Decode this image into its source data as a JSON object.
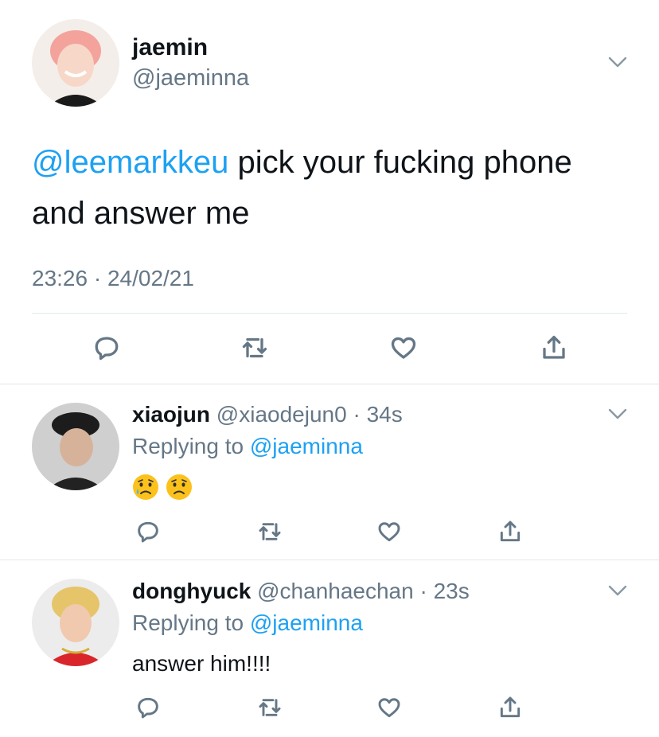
{
  "main_tweet": {
    "display_name": "jaemin",
    "handle": "@jaeminna",
    "mention": "@leemarkkeu",
    "text_line1": " pick your fucking phone",
    "text_line2": "and answer me",
    "timestamp": "23:26 · 24/02/21"
  },
  "replies": [
    {
      "display_name": "xiaojun",
      "handle": "@xiaodejun0",
      "time": "34s",
      "replying_prefix": "Replying to ",
      "replying_handle": "@jaeminna",
      "content": "emoji: sad-relieved-face x2"
    },
    {
      "display_name": "donghyuck",
      "handle": "@chanhaechan",
      "time": "23s",
      "replying_prefix": "Replying to ",
      "replying_handle": "@jaeminna",
      "content": "answer him!!!!"
    }
  ],
  "icons": {
    "reply": "comment-icon",
    "retweet": "retweet-icon",
    "like": "heart-icon",
    "share": "share-icon",
    "menu": "chevron-down-icon"
  },
  "colors": {
    "accent": "#1da1f2",
    "muted": "#657786",
    "text": "#0f1419",
    "divider": "#e1e8ed"
  }
}
